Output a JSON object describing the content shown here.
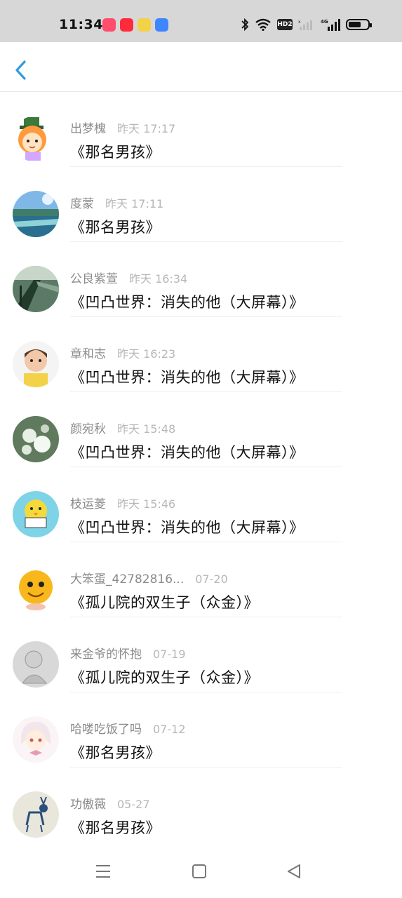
{
  "status_bar": {
    "time": "11:34",
    "hd_label": "HD2",
    "network_label": "4G",
    "battery_level": 0.65
  },
  "header": {
    "back_icon": "chevron-left-icon",
    "accent_color": "#2f9bdc"
  },
  "items": [
    {
      "name": "出梦槐",
      "time": "昨天 17:17",
      "content": "《那名男孩》",
      "avatar": "cartoon-girl-hat"
    },
    {
      "name": "度蒙",
      "time": "昨天 17:11",
      "content": "《那名男孩》",
      "avatar": "sea-landscape"
    },
    {
      "name": "公良紫萱",
      "time": "昨天 16:34",
      "content": "《凹凸世界：消失的他（大屏幕）》",
      "avatar": "railing-road"
    },
    {
      "name": "章和志",
      "time": "昨天 16:23",
      "content": "《凹凸世界：消失的他（大屏幕）》",
      "avatar": "little-girl"
    },
    {
      "name": "颜宛秋",
      "time": "昨天 15:48",
      "content": "《凹凸世界：消失的他（大屏幕）》",
      "avatar": "white-flowers"
    },
    {
      "name": "枝运菱",
      "time": "昨天 15:46",
      "content": "《凹凸世界：消失的他（大屏幕）》",
      "avatar": "yellow-bird"
    },
    {
      "name": "大笨蛋_42782816...",
      "time": "07-20",
      "content": "《孤儿院的双生子（众金）》",
      "avatar": "smiley-face"
    },
    {
      "name": "来金爷的怀抱",
      "time": "07-19",
      "content": "《孤儿院的双生子（众金）》",
      "avatar": "gray-sketch"
    },
    {
      "name": "哈喽吃饭了吗",
      "time": "07-12",
      "content": "《那名男孩》",
      "avatar": "anime-girl"
    },
    {
      "name": "功傲薇",
      "time": "05-27",
      "content": "《那名男孩》",
      "avatar": "deer"
    }
  ],
  "bottom_nav": {
    "menu_icon": "menu-icon",
    "home_icon": "home-square-icon",
    "back_icon": "back-triangle-icon"
  }
}
